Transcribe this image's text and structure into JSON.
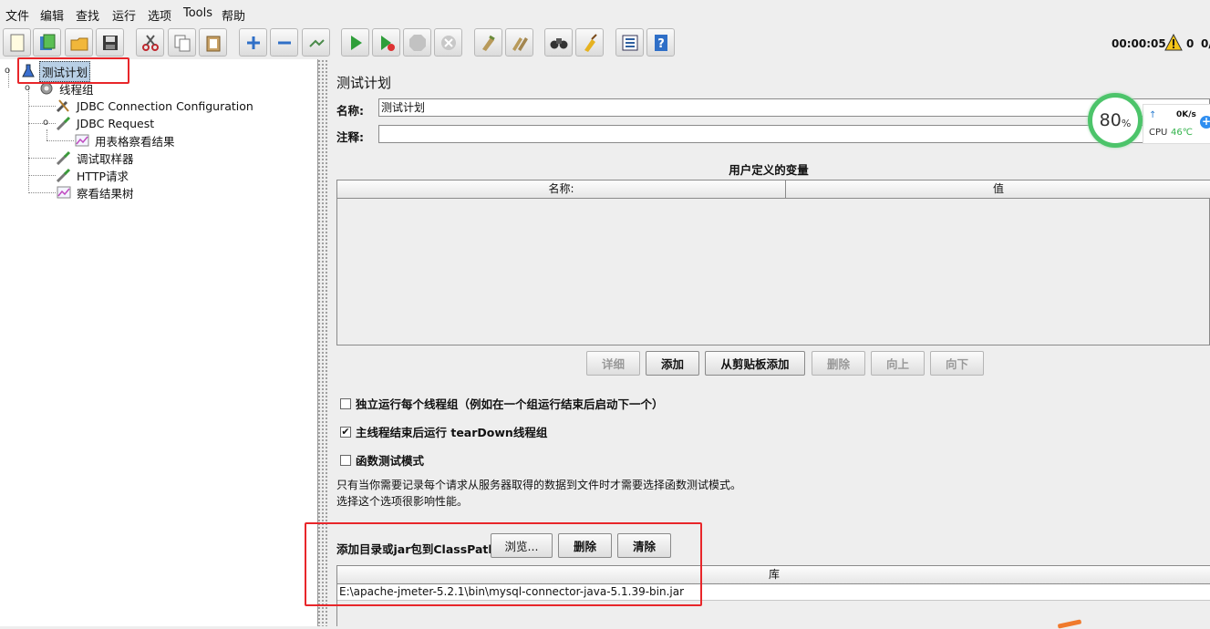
{
  "menu": [
    "文件",
    "编辑",
    "查找",
    "运行",
    "选项",
    "Tools",
    "帮助"
  ],
  "toolbar": {
    "buttons": [
      "new-icon",
      "templates-icon",
      "open-icon",
      "save-icon",
      "cut-icon",
      "copy-icon",
      "paste-icon",
      "expand-icon",
      "collapse-icon",
      "toggle-icon",
      "start-icon",
      "start-no-pause-icon",
      "stop-icon",
      "shutdown-icon",
      "clear-icon",
      "clear-all-icon",
      "search-icon",
      "reset-search-icon",
      "function-helper-icon",
      "help-icon"
    ],
    "timer": "00:00:05",
    "warning_count": "0",
    "error_count": "0/"
  },
  "tree": {
    "items": [
      {
        "label": "测试计划",
        "icon": "test-plan-icon"
      },
      {
        "label": "线程组",
        "icon": "thread-group-icon"
      },
      {
        "label": "JDBC Connection Configuration",
        "icon": "config-wrench-icon"
      },
      {
        "label": "JDBC Request",
        "icon": "sampler-pipette-icon"
      },
      {
        "label": "用表格察看结果",
        "icon": "listener-chart-icon"
      },
      {
        "label": "调试取样器",
        "icon": "sampler-pipette-icon"
      },
      {
        "label": "HTTP请求",
        "icon": "sampler-pipette-icon"
      },
      {
        "label": "察看结果树",
        "icon": "listener-chart-icon"
      }
    ]
  },
  "panel": {
    "title": "测试计划",
    "name_label": "名称:",
    "name_value": "测试计划",
    "comment_label": "注释:",
    "comment_value": "",
    "vars_title": "用户定义的变量",
    "vars_columns": [
      "名称:",
      "值"
    ],
    "buttons": {
      "detail": "详细",
      "add": "添加",
      "add_clipboard": "从剪贴板添加",
      "delete": "删除",
      "up": "向上",
      "down": "向下"
    },
    "checkboxes": [
      {
        "label": "独立运行每个线程组（例如在一个组运行结束后启动下一个）",
        "checked": false
      },
      {
        "label": "主线程结束后运行 tearDown线程组",
        "checked": true
      },
      {
        "label": "函数测试模式",
        "checked": false
      }
    ],
    "note_line1": "只有当你需要记录每个请求从服务器取得的数据到文件时才需要选择函数测试模式。",
    "note_line2": "选择这个选项很影响性能。",
    "classpath_label": "添加目录或jar包到ClassPath",
    "classpath_buttons": {
      "browse": "浏览...",
      "delete": "删除",
      "clear": "清除"
    },
    "library_header": "库",
    "library_rows": [
      "E:\\apache-jmeter-5.2.1\\bin\\mysql-connector-java-5.1.39-bin.jar"
    ]
  },
  "cpu_widget": {
    "percent": "80",
    "percent_sign": "%",
    "speed": "0K/s",
    "cpu_label": "CPU",
    "temp": "46℃",
    "ring_color": "#4cc46a",
    "temp_color": "#31b24a"
  },
  "colors": {
    "highlight_box": "#e8262a",
    "selection": "#b8cfe5"
  }
}
